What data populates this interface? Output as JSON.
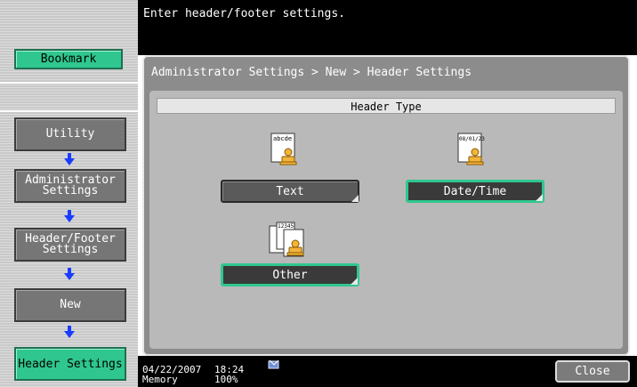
{
  "sidebar": {
    "bookmark_label": "Bookmark",
    "breadcrumbs": [
      {
        "label": "Utility"
      },
      {
        "label": "Administrator\nSettings"
      },
      {
        "label": "Header/Footer\nSettings"
      },
      {
        "label": "New"
      }
    ],
    "current_label": "Header Settings"
  },
  "header": {
    "message": "Enter header/footer settings."
  },
  "panel": {
    "breadcrumb": "Administrator Settings > New > Header Settings",
    "section_title": "Header Type",
    "options": [
      {
        "label": "Text",
        "icon": "text-stamp-icon",
        "icon_text": "abcde"
      },
      {
        "label": "Date/Time",
        "icon": "date-time-stamp-icon",
        "icon_text": "08/01/23"
      },
      {
        "label": "Other",
        "icon": "other-stamp-icon",
        "icon_text": "12345"
      }
    ]
  },
  "status": {
    "date": "04/22/2007",
    "time": "18:24",
    "memory_label": "Memory",
    "memory_value": "100%",
    "close_label": "Close"
  },
  "colors": {
    "accent": "#2fc78f",
    "button_grey": "#767676",
    "panel_bg": "#8c8c8c",
    "bar_bg": "#000000"
  }
}
